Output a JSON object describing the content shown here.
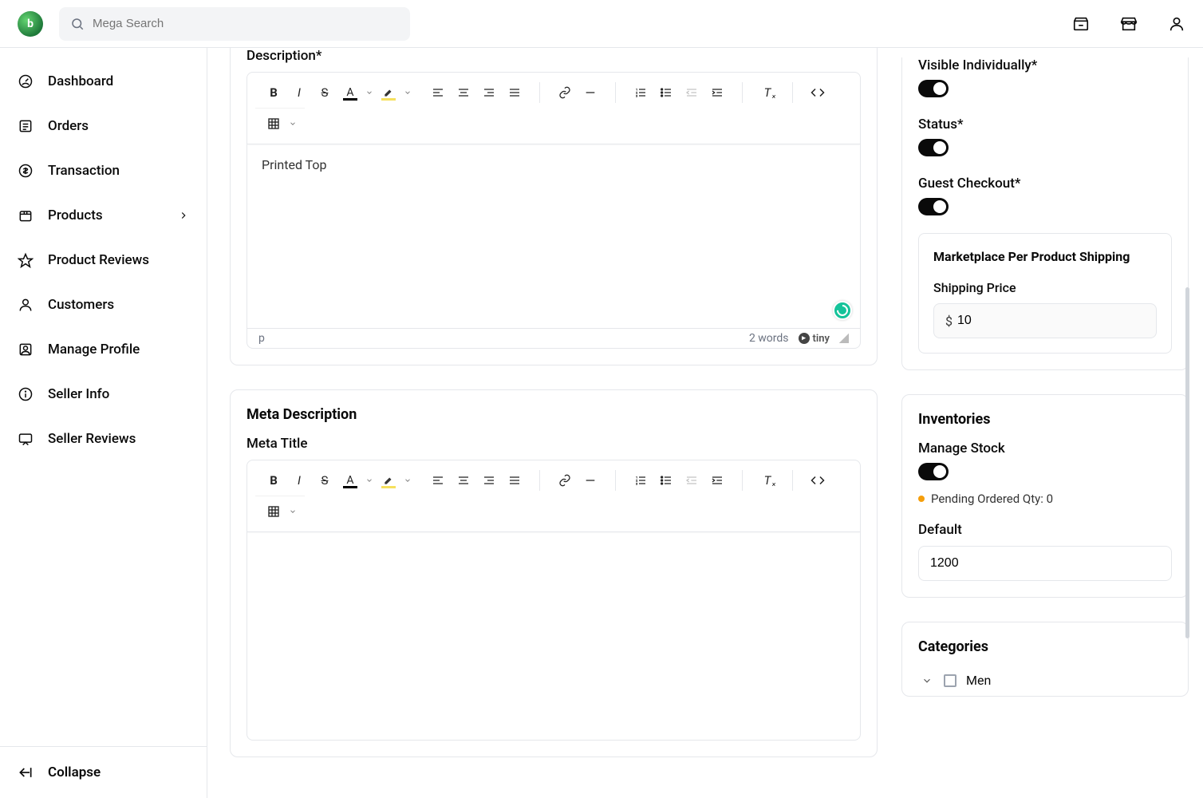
{
  "header": {
    "search_placeholder": "Mega Search"
  },
  "sidebar": {
    "items": [
      {
        "label": "Dashboard",
        "icon": "gauge"
      },
      {
        "label": "Orders",
        "icon": "list"
      },
      {
        "label": "Transaction",
        "icon": "dollar"
      },
      {
        "label": "Products",
        "icon": "box",
        "has_children": true
      },
      {
        "label": "Product Reviews",
        "icon": "star"
      },
      {
        "label": "Customers",
        "icon": "user"
      },
      {
        "label": "Manage Profile",
        "icon": "profile"
      },
      {
        "label": "Seller Info",
        "icon": "info"
      },
      {
        "label": "Seller Reviews",
        "icon": "review"
      }
    ],
    "collapse_label": "Collapse"
  },
  "description": {
    "label": "Description*",
    "content": "Printed Top",
    "path": "p",
    "word_count": "2 words",
    "tiny_label": "tiny"
  },
  "meta": {
    "section_title": "Meta Description",
    "title_label": "Meta Title"
  },
  "settings_panel": {
    "visible_label": "Visible Individually*",
    "visible_value": true,
    "status_label": "Status*",
    "status_value": true,
    "guest_label": "Guest Checkout*",
    "guest_value": true,
    "shipping_card_title": "Marketplace Per Product Shipping",
    "shipping_price_label": "Shipping Price",
    "shipping_price_prefix": "$",
    "shipping_price_value": "10"
  },
  "inventories": {
    "title": "Inventories",
    "manage_label": "Manage Stock",
    "manage_value": true,
    "pending_label": "Pending Ordered Qty: 0",
    "default_label": "Default",
    "default_value": "1200"
  },
  "categories": {
    "title": "Categories",
    "items": [
      {
        "label": "Men",
        "expanded": true,
        "checked": false
      }
    ]
  }
}
